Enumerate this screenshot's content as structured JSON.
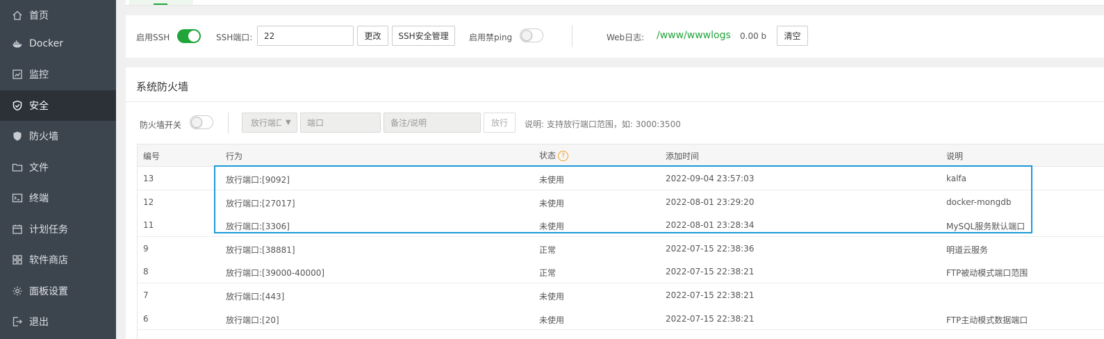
{
  "sidebar": {
    "items": [
      {
        "label": "首页",
        "icon": "home-icon",
        "active": false
      },
      {
        "label": "Docker",
        "icon": "docker-icon",
        "active": false
      },
      {
        "label": "监控",
        "icon": "monitor-icon",
        "active": false
      },
      {
        "label": "安全",
        "icon": "shield-check-icon",
        "active": true
      },
      {
        "label": "防火墙",
        "icon": "shield-icon",
        "active": false
      },
      {
        "label": "文件",
        "icon": "folder-icon",
        "active": false
      },
      {
        "label": "终端",
        "icon": "terminal-icon",
        "active": false
      },
      {
        "label": "计划任务",
        "icon": "calendar-icon",
        "active": false
      },
      {
        "label": "软件商店",
        "icon": "apps-icon",
        "active": false
      },
      {
        "label": "面板设置",
        "icon": "gear-icon",
        "active": false
      },
      {
        "label": "退出",
        "icon": "logout-icon",
        "active": false
      }
    ]
  },
  "ssh": {
    "enable_label": "启用SSH",
    "enabled": true,
    "port_label": "SSH端口:",
    "port_value": "22",
    "change_button": "更改",
    "manage_button": "SSH安全管理",
    "ping_label": "启用禁ping",
    "ping_enabled": false,
    "weblog_label": "Web日志:",
    "weblog_path": "/www/wwwlogs",
    "weblog_size": "0.00 b",
    "clear_button": "清空"
  },
  "firewall": {
    "title": "系统防火墙",
    "switch_label": "防火墙开关",
    "switch_on": false,
    "select_value": "放行端口",
    "port_placeholder": "端口",
    "remark_placeholder": "备注/说明",
    "allow_button": "放行",
    "note": "说明: 支持放行端口范围，如: 3000:3500"
  },
  "table": {
    "columns": [
      "编号",
      "行为",
      "状态",
      "添加时间",
      "说明"
    ],
    "rows": [
      {
        "id": "13",
        "action": "放行端口:[9092]",
        "status": "未使用",
        "time": "2022-09-04 23:57:03",
        "remark": "kalfa"
      },
      {
        "id": "12",
        "action": "放行端口:[27017]",
        "status": "未使用",
        "time": "2022-08-01 23:29:20",
        "remark": "docker-mongdb"
      },
      {
        "id": "11",
        "action": "放行端口:[3306]",
        "status": "未使用",
        "time": "2022-08-01 23:28:34",
        "remark": "MySQL服务默认端口"
      },
      {
        "id": "9",
        "action": "放行端口:[38881]",
        "status": "正常",
        "time": "2022-07-15 22:38:36",
        "remark": "明道云服务"
      },
      {
        "id": "8",
        "action": "放行端口:[39000-40000]",
        "status": "正常",
        "time": "2022-07-15 22:38:21",
        "remark": "FTP被动模式端口范围"
      },
      {
        "id": "7",
        "action": "放行端口:[443]",
        "status": "未使用",
        "time": "2022-07-15 22:38:21",
        "remark": ""
      },
      {
        "id": "6",
        "action": "放行端口:[20]",
        "status": "未使用",
        "time": "2022-07-15 22:38:21",
        "remark": "FTP主动模式数据端口"
      }
    ]
  },
  "colors": {
    "accent": "#20a53a",
    "highlight": "#1a9ad6",
    "sidebar": "#3c444d"
  }
}
